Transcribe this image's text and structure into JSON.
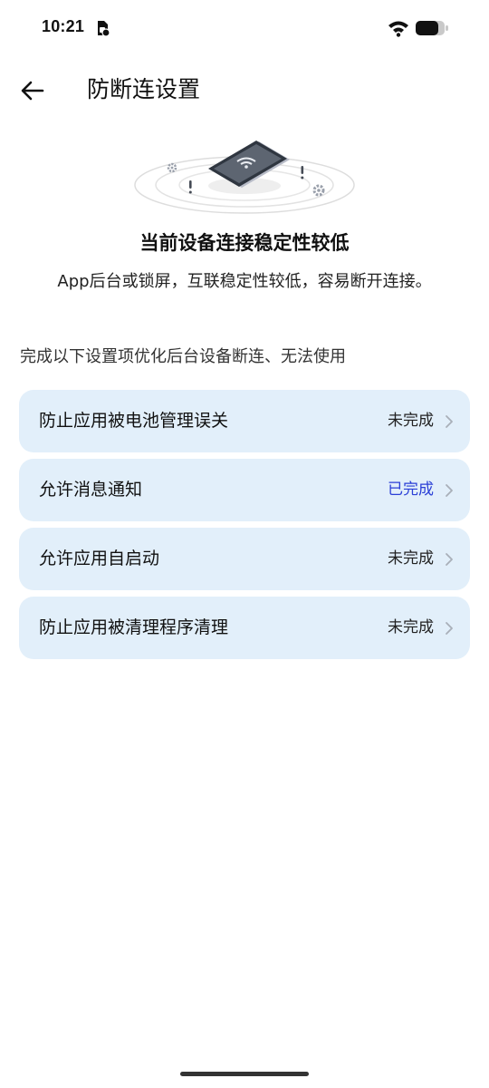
{
  "status_bar": {
    "time": "10:21",
    "icons": [
      "sim-card-icon",
      "wifi-icon",
      "battery-icon"
    ]
  },
  "header": {
    "back_icon": "back-arrow-icon",
    "title": "防断连设置"
  },
  "hero": {
    "illustration": "phone-wifi-illustration",
    "title": "当前设备连接稳定性较低",
    "subtitle": "App后台或锁屏，互联稳定性较低，容易断开连接。"
  },
  "section": {
    "description": "完成以下设置项优化后台设备断连、无法使用"
  },
  "settings": {
    "items": [
      {
        "label": "防止应用被电池管理误关",
        "status": "未完成",
        "completed": false
      },
      {
        "label": "允许消息通知",
        "status": "已完成",
        "completed": true
      },
      {
        "label": "允许应用自启动",
        "status": "未完成",
        "completed": false
      },
      {
        "label": "防止应用被清理程序清理",
        "status": "未完成",
        "completed": false
      }
    ]
  },
  "colors": {
    "card_background": "#e2effa",
    "completed_status": "#2a3fd6",
    "page_background": "#ffffff"
  }
}
